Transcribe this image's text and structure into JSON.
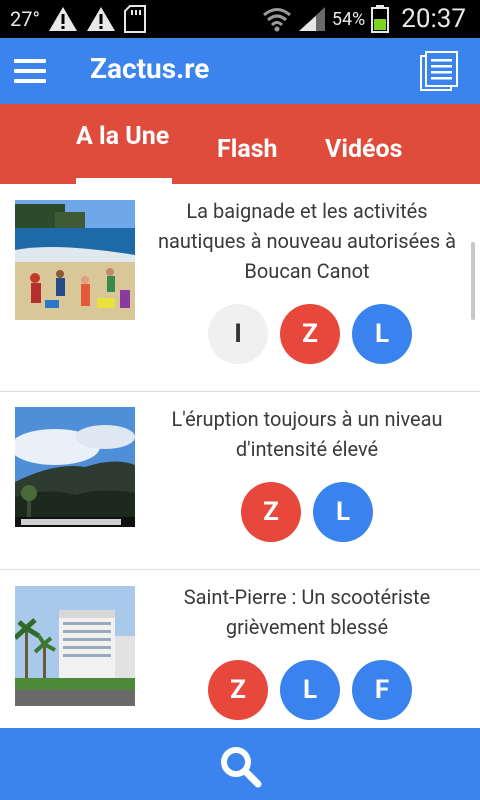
{
  "status_bar": {
    "temperature": "27°",
    "battery_percent": "54%",
    "time": "20:37"
  },
  "app_bar": {
    "title": "Zactus.re",
    "menu_icon": "hamburger-menu-icon",
    "news_icon": "newspaper-icon"
  },
  "tabs": [
    {
      "label": "A la Une",
      "active": true
    },
    {
      "label": "Flash",
      "active": false
    },
    {
      "label": "Vidéos",
      "active": false
    }
  ],
  "articles": [
    {
      "title": "La baignade et les activités nautiques à nouveau autorisées à Boucan Canot",
      "badges": [
        {
          "letter": "I",
          "color": "#f0f0f0"
        },
        {
          "letter": "Z",
          "color": "#e8473b"
        },
        {
          "letter": "L",
          "color": "#3a82ee"
        }
      ]
    },
    {
      "title": "L'éruption toujours à un niveau d'intensité élevé",
      "badges": [
        {
          "letter": "Z",
          "color": "#e8473b"
        },
        {
          "letter": "L",
          "color": "#3a82ee"
        }
      ]
    },
    {
      "title": "Saint-Pierre : Un scootériste grièvement blessé",
      "badges": [
        {
          "letter": "Z",
          "color": "#e8473b"
        },
        {
          "letter": "L",
          "color": "#3a82ee"
        },
        {
          "letter": "F",
          "color": "#3a82ee"
        }
      ]
    }
  ],
  "bottom_bar": {
    "search_icon": "search-icon"
  },
  "colors": {
    "app_bar": "#3b84ee",
    "tab_bar": "#e04c3c",
    "status_bar": "#000000"
  }
}
